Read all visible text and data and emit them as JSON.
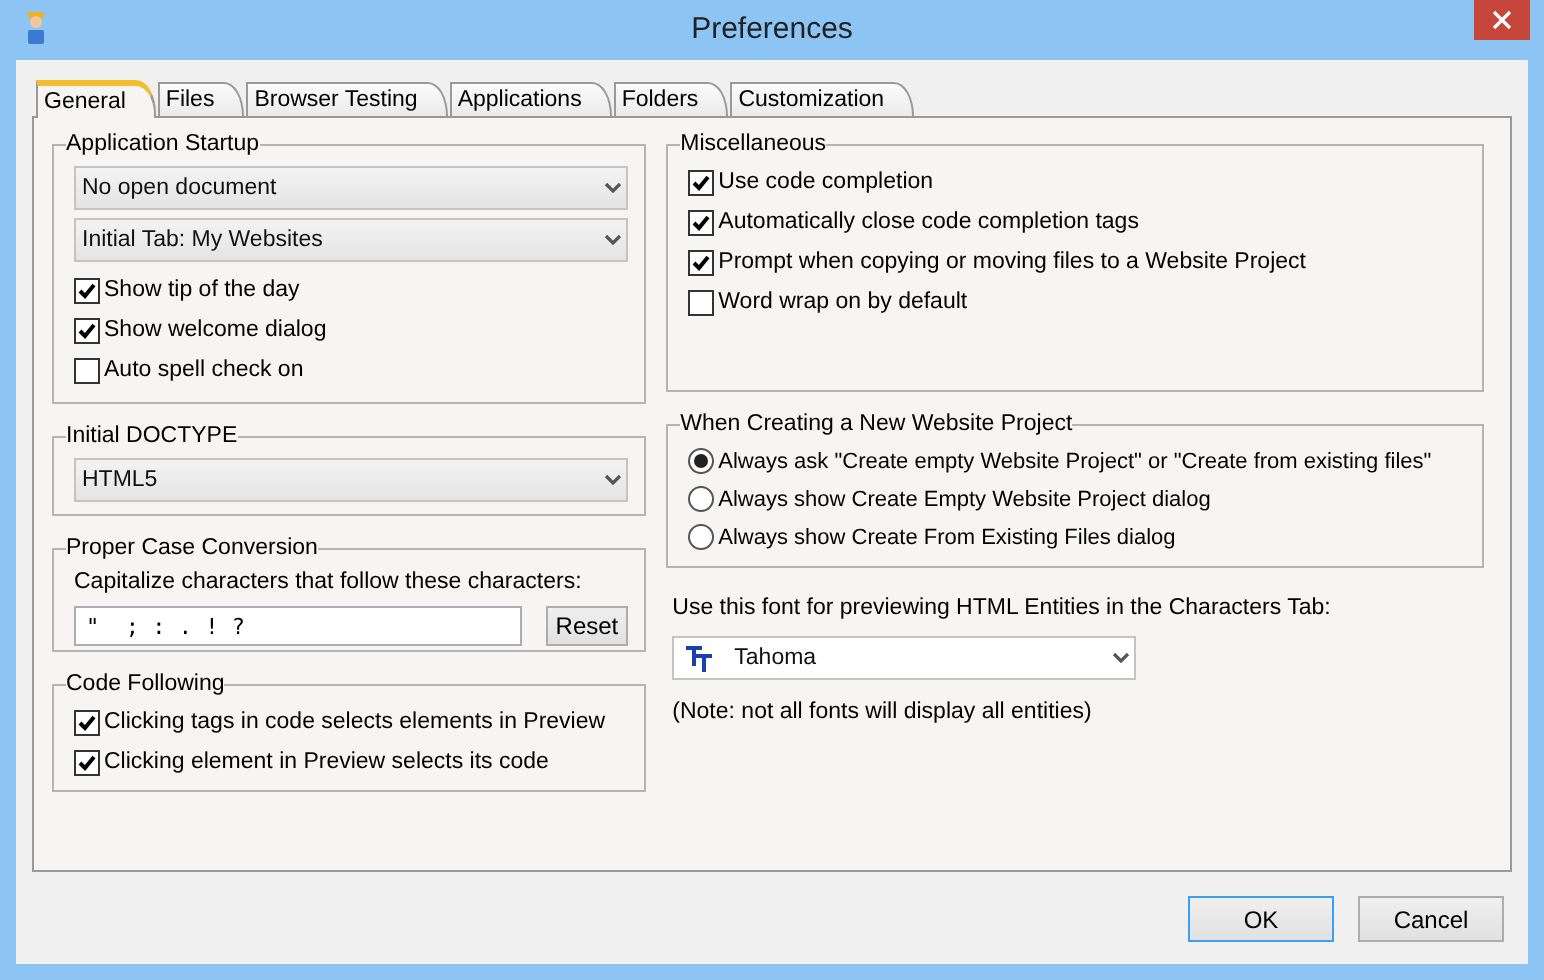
{
  "window": {
    "title": "Preferences"
  },
  "tabs": [
    {
      "label": "General",
      "selected": true
    },
    {
      "label": "Files",
      "selected": false
    },
    {
      "label": "Browser Testing",
      "selected": false
    },
    {
      "label": "Applications",
      "selected": false
    },
    {
      "label": "Folders",
      "selected": false
    },
    {
      "label": "Customization",
      "selected": false
    }
  ],
  "application_startup": {
    "title": "Application Startup",
    "dropdowns": [
      "No open document",
      "Initial Tab: My Websites"
    ],
    "options": [
      {
        "label": "Show tip of the day",
        "checked": true
      },
      {
        "label": "Show welcome dialog",
        "checked": true
      },
      {
        "label": "Auto spell check on",
        "checked": false
      }
    ]
  },
  "initial_doctype": {
    "title": "Initial DOCTYPE",
    "value": "HTML5"
  },
  "proper_case": {
    "title": "Proper Case Conversion",
    "label": "Capitalize characters that follow these characters:",
    "value": "\"  ; : . ! ?",
    "button": "Reset"
  },
  "code_following": {
    "title": "Code Following",
    "options": [
      {
        "label": "Clicking tags in code selects elements in Preview",
        "checked": true
      },
      {
        "label": "Clicking element in Preview selects its code",
        "checked": true
      }
    ]
  },
  "miscellaneous": {
    "title": "Miscellaneous",
    "options": [
      {
        "label": "Use code completion",
        "checked": true
      },
      {
        "label": "Automatically close code completion tags",
        "checked": true
      },
      {
        "label": "Prompt when copying or moving files to a Website Project",
        "checked": true
      },
      {
        "label": "Word wrap on by default",
        "checked": false
      }
    ]
  },
  "new_project": {
    "title": "When Creating a New Website Project",
    "options": [
      {
        "label": "Always ask \"Create empty Website Project\" or \"Create from existing files\"",
        "selected": true
      },
      {
        "label": "Always show Create Empty Website Project dialog",
        "selected": false
      },
      {
        "label": "Always show Create From Existing Files dialog",
        "selected": false
      }
    ]
  },
  "entity_font": {
    "label": "Use this font for previewing HTML Entities in the Characters Tab:",
    "value": "Tahoma",
    "note": "(Note: not all fonts will display all entities)"
  },
  "buttons": [
    {
      "label": "OK",
      "default": true
    },
    {
      "label": "Cancel",
      "default": false
    }
  ]
}
